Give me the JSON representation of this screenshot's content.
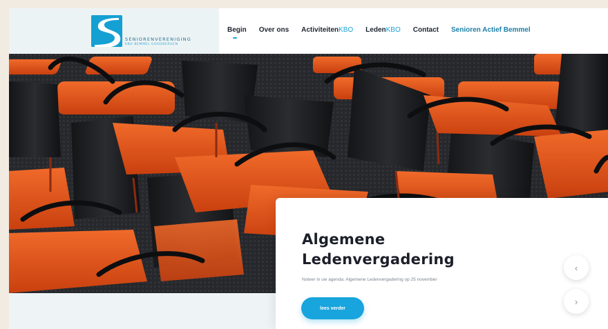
{
  "header": {
    "logo": {
      "title": "SENIORENVERENIGING",
      "subtitle": "KBO BEMMEL GOUDBERGEN"
    },
    "nav": [
      {
        "label": "Begin",
        "suffix": "",
        "active": true
      },
      {
        "label": "Over ons",
        "suffix": ""
      },
      {
        "label": "Activiteiten",
        "suffix": "KBO"
      },
      {
        "label": "Leden",
        "suffix": "KBO"
      },
      {
        "label": "Contact",
        "suffix": ""
      },
      {
        "label": "Senioren Actief Bemmel",
        "suffix": ""
      }
    ]
  },
  "slide": {
    "title_line1": "Algemene",
    "title_line2": "Ledenvergadering",
    "text": "Noteer in uw agenda: Algemene Ledenvergadering op 25 november",
    "button_label": "lees verder",
    "prev_icon": "chevron-left-icon",
    "next_icon": "chevron-right-icon"
  },
  "colors": {
    "accent": "#18a4dc",
    "chair_seat": "#e0501d",
    "text_dark": "#1b1f29"
  }
}
